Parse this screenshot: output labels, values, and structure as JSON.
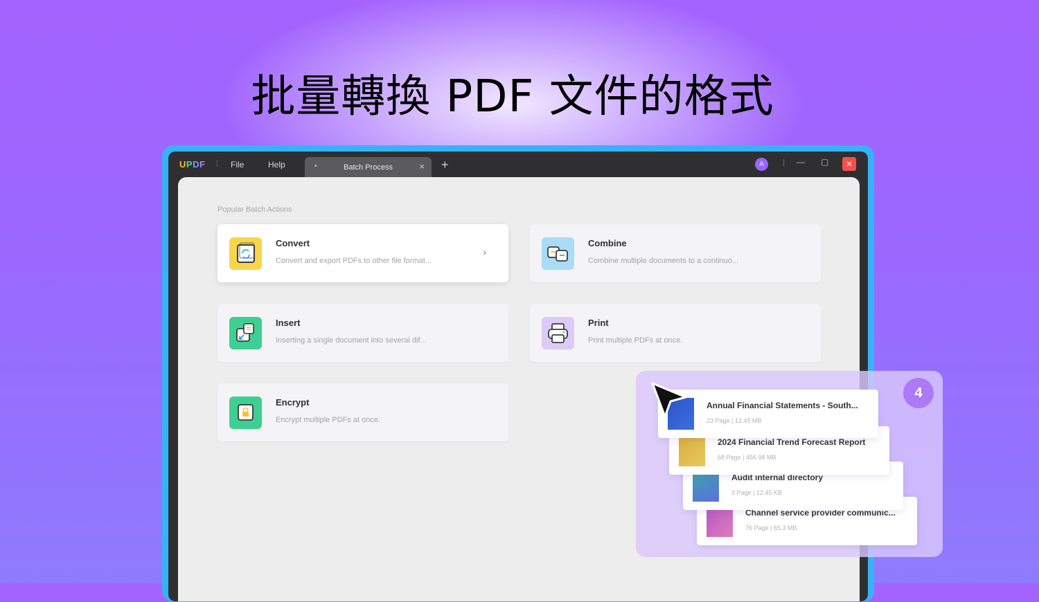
{
  "headline": "批量轉換 PDF 文件的格式",
  "app": {
    "logo": {
      "u": "U",
      "p": "P",
      "d": "D",
      "f": "F"
    },
    "menu": [
      "File",
      "Help"
    ],
    "tab": {
      "label": "Batch Process",
      "close": "×",
      "dot": "•"
    },
    "new_tab": "+",
    "avatar_initial": "A",
    "window_controls": {
      "minimize": "—",
      "maximize": "▢",
      "close": "✕",
      "divider": "|"
    }
  },
  "main": {
    "section_label": "Popular Batch Actions",
    "actions": [
      {
        "title": "Convert",
        "desc": "Convert and export PDFs to other file format...",
        "icon": "convert-icon",
        "color": "#f7d64a",
        "chevron": "›"
      },
      {
        "title": "Combine",
        "desc": "Combine multiple documents to a continuo...",
        "icon": "combine-icon",
        "color": "#a9dcf7"
      },
      {
        "title": "Insert",
        "desc": "Inserting a single document into several dif...",
        "icon": "insert-icon",
        "color": "#3ed093"
      },
      {
        "title": "Print",
        "desc": "Print multiple PDFs at once.",
        "icon": "print-icon",
        "color": "#dccaf8"
      },
      {
        "title": "Encrypt",
        "desc": "Encrypt multiple PDFs at once.",
        "icon": "encrypt-icon",
        "color": "#3ed093"
      }
    ]
  },
  "files_panel": {
    "count": "4",
    "files": [
      {
        "name": "Annual Financial Statements - South...",
        "meta": "23 Page  |  12.45 MB",
        "thumb_color": "#2d55c8"
      },
      {
        "name": "2024 Financial Trend Forecast Report",
        "meta": "68 Page  |  456.98 MB",
        "thumb_color": "#d8ae37"
      },
      {
        "name": "Audit internal directory",
        "meta": "3 Page  |  12.45 KB",
        "thumb_color": "#3aa7a6"
      },
      {
        "name": "Channel service provider communic...",
        "meta": "76 Page  |  65.3 MB",
        "thumb_color": "#b357c8"
      }
    ]
  }
}
